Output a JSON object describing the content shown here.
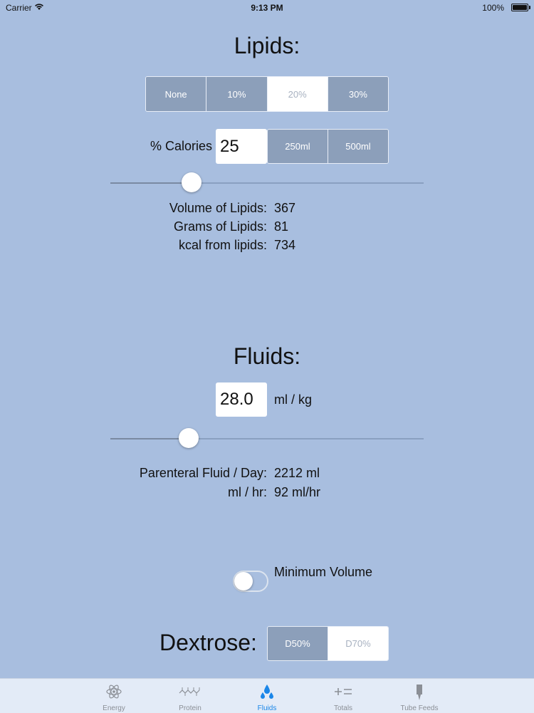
{
  "status_bar": {
    "carrier": "Carrier",
    "time": "9:13 PM",
    "battery": "100%"
  },
  "lipids": {
    "title": "Lipids:",
    "concentration_options": [
      "None",
      "10%",
      "20%",
      "30%"
    ],
    "concentration_selected": "20%",
    "percent_calories_label": "% Calories",
    "percent_calories_value": "25",
    "volume_options": [
      "250ml",
      "500ml"
    ],
    "slider_fraction": 0.26,
    "results": [
      {
        "label": "Volume of Lipids:",
        "value": "367"
      },
      {
        "label": "Grams of Lipids:",
        "value": "81"
      },
      {
        "label": "kcal from lipids:",
        "value": "734"
      }
    ]
  },
  "fluids": {
    "title": "Fluids:",
    "value": "28.0",
    "unit": "ml / kg",
    "slider_fraction": 0.25,
    "results": [
      {
        "label": "Parenteral Fluid / Day:",
        "value": "2212 ml"
      },
      {
        "label": "ml / hr:",
        "value": "92 ml/hr"
      }
    ],
    "minimum_volume_label": "Minimum Volume",
    "minimum_volume_on": false
  },
  "dextrose": {
    "title": "Dextrose:",
    "options": [
      "D50%",
      "D70%"
    ],
    "selected": "D70%"
  },
  "tabs": [
    {
      "label": "Energy",
      "icon": "atom-icon"
    },
    {
      "label": "Protein",
      "icon": "molecule-chain-icon"
    },
    {
      "label": "Fluids",
      "icon": "droplets-icon",
      "active": true
    },
    {
      "label": "Totals",
      "icon": "plus-equals-icon"
    },
    {
      "label": "Tube Feeds",
      "icon": "feeding-tube-icon"
    }
  ],
  "colors": {
    "background": "#a8bedf",
    "segment_unselected": "#8c9fba",
    "accent_active_tab": "#1a86e8"
  }
}
